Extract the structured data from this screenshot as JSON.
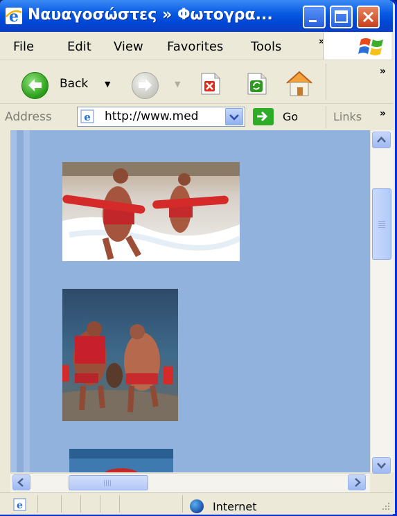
{
  "window": {
    "title": "Ναυαγοσώστες » Φωτογρα..."
  },
  "menu": {
    "file": "File",
    "edit": "Edit",
    "view": "View",
    "favorites": "Favorites",
    "tools": "Tools",
    "overflow": "»"
  },
  "toolbar": {
    "back_label": "Back",
    "overflow": "»",
    "icons": [
      "back-arrow",
      "forward-arrow",
      "stop",
      "refresh",
      "home"
    ]
  },
  "address": {
    "label": "Address",
    "url": "http://www.med",
    "go_label": "Go",
    "links_label": "Links",
    "overflow": "»"
  },
  "status": {
    "zone": "Internet"
  },
  "colors": {
    "title_bar": "#0a5ce3",
    "page_background": "#90b2dd",
    "chrome": "#ece9d8"
  }
}
